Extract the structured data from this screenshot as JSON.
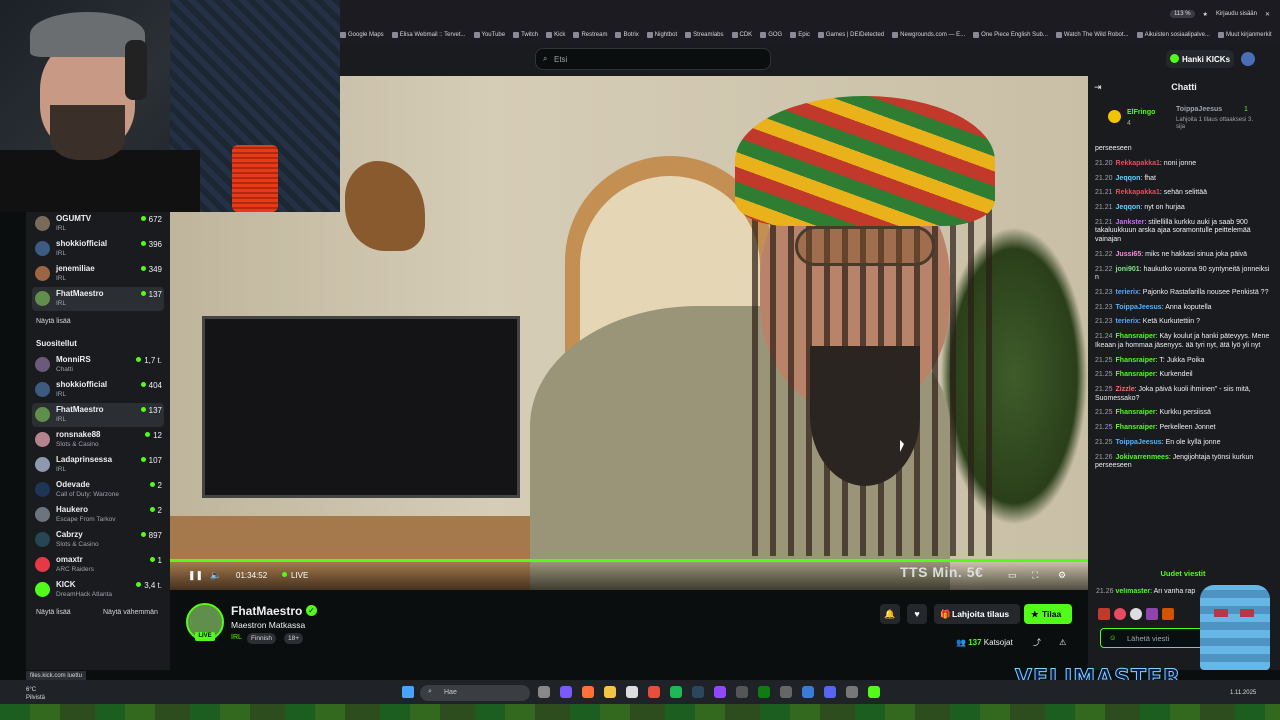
{
  "browser": {
    "bookmarks": [
      "Google Maps",
      "Elisa Webmail :: Tervet...",
      "YouTube",
      "Twitch",
      "Kick",
      "Restream",
      "Botrix",
      "Nightbot",
      "Streamlabs",
      "CDK",
      "GOG",
      "Epic",
      "Games | DEIDetected",
      "Newgrounds.com — E...",
      "One Piece English Sub...",
      "Watch The Wild Robot...",
      "Aikuisten sosiaalipalve...",
      "Muut kirjanmerkit"
    ],
    "zoom": "113 %",
    "login_label": "Kirjaudu sisään"
  },
  "header": {
    "search_placeholder": "Etsi",
    "kicks_button": "Hanki KICKs"
  },
  "sidebar": {
    "followed": [
      {
        "name": "OGUMTV",
        "category": "IRL",
        "viewers": "672"
      },
      {
        "name": "shokkiofficial",
        "category": "IRL",
        "viewers": "396"
      },
      {
        "name": "jenemiliae",
        "category": "IRL",
        "viewers": "349"
      },
      {
        "name": "FhatMaestro",
        "category": "IRL",
        "viewers": "137"
      }
    ],
    "show_more": "Näytä lisää",
    "recommended_heading": "Suositellut",
    "recommended": [
      {
        "name": "MonniRS",
        "category": "Chatti",
        "viewers": "1,7 t."
      },
      {
        "name": "shokkiofficial",
        "category": "IRL",
        "viewers": "404"
      },
      {
        "name": "FhatMaestro",
        "category": "IRL",
        "viewers": "137"
      },
      {
        "name": "ronsnake88",
        "category": "Slots & Casino",
        "viewers": "12"
      },
      {
        "name": "Ladaprinsessa",
        "category": "IRL",
        "viewers": "107"
      },
      {
        "name": "Odevade",
        "category": "Call of Duty: Warzone",
        "viewers": "2"
      },
      {
        "name": "Haukero",
        "category": "Escape From Tarkov",
        "viewers": "2"
      },
      {
        "name": "Cabrzy",
        "category": "Slots & Casino",
        "viewers": "897"
      },
      {
        "name": "omaxtr",
        "category": "ARC Raiders",
        "viewers": "1"
      },
      {
        "name": "KICK",
        "category": "DreamHack Atlanta",
        "viewers": "3,4 t."
      }
    ],
    "show_more_2": "Näytä lisää",
    "show_less": "Näytä vähemmän"
  },
  "player": {
    "time": "01:34:52",
    "live_label": "LIVE",
    "overlay_text": "TTS Min. 5€"
  },
  "channel": {
    "name": "FhatMaestro",
    "live_badge": "LIVE",
    "title": "Maestron Matkassa",
    "category": "IRL",
    "tags": [
      "Finnish",
      "18+"
    ],
    "gift_label": "Lahjoita tilaus",
    "subscribe_label": "Tilaa",
    "viewer_count": "137",
    "viewer_label": "Katsojat"
  },
  "chat": {
    "title": "Chatti",
    "pinned": {
      "rank1_user": "ElFringo",
      "rank1_count": "4",
      "user": "ToippaJeesus",
      "count": "1",
      "text": "Lahjoita 1 tilaus ottaaksesi 3. sija"
    },
    "messages": [
      {
        "time": "",
        "user": "",
        "color": "#efeff1",
        "text": "perseeseen"
      },
      {
        "time": "21.20",
        "user": "Rekkapakka1",
        "color": "#e84a5f",
        "text": "noni jonne"
      },
      {
        "time": "21.20",
        "user": "Jeqqon",
        "color": "#58d6ff",
        "text": "fhat"
      },
      {
        "time": "21.21",
        "user": "Rekkapakka1",
        "color": "#e84a5f",
        "text": "sehän selittää"
      },
      {
        "time": "21.21",
        "user": "Jeqqon",
        "color": "#58d6ff",
        "text": "nyt on hurjaa"
      },
      {
        "time": "21.21",
        "user": "Jankster",
        "color": "#c86bfa",
        "text": "stilellillä kurkku auki ja saab 900 takaluukkuun arska ajaa soramontulle peittelemää vainajan"
      },
      {
        "time": "21.22",
        "user": "Jussi65",
        "color": "#ff8ad8",
        "text": "miks ne hakkasi sinua joka päivä"
      },
      {
        "time": "21.22",
        "user": "joni901",
        "color": "#7ee787",
        "text": "haukutko vuonna 90 syntyneitä jonneiksi n"
      },
      {
        "time": "21.23",
        "user": "terierix",
        "color": "#58a6ff",
        "text": "Pajonko Rastafarilla nousee Penkistä ??"
      },
      {
        "time": "21.23",
        "user": "ToippaJeesus",
        "color": "#4fb3ff",
        "text": "Anna koputella"
      },
      {
        "time": "21.23",
        "user": "terierix",
        "color": "#58a6ff",
        "text": "Ketä Kurkutettiin ?"
      },
      {
        "time": "21.24",
        "user": "Fhansraiper",
        "color": "#53fc18",
        "text": "Käy koulut ja hanki pätevyys. Mene Ikeaan ja hommaa jäsenyys. ää tyri nyt, ätä lyö yli nyt"
      },
      {
        "time": "21.25",
        "user": "Fhansraiper",
        "color": "#53fc18",
        "text": "T: Jukka Poika"
      },
      {
        "time": "21.25",
        "user": "Fhansraiper",
        "color": "#53fc18",
        "text": "Kurkendeil"
      },
      {
        "time": "21.25",
        "user": "Zizzle",
        "color": "#ff6b6b",
        "text": "Joka päivä kuoli ihminen\" - siis mitä, Suomessako?"
      },
      {
        "time": "21.25",
        "user": "Fhansraiper",
        "color": "#53fc18",
        "text": "Kurkku persiissä"
      },
      {
        "time": "21.25",
        "user": "Fhansraiper",
        "color": "#53fc18",
        "text": "Perkelleen Jonnet"
      },
      {
        "time": "21.25",
        "user": "ToippaJeesus",
        "color": "#4fb3ff",
        "text": "En ole kyllä jonne"
      },
      {
        "time": "21.26",
        "user": "Jokivarrenmees",
        "color": "#53fc18",
        "text": "Jengijohtaja työnsi kurkun perseeseen"
      }
    ],
    "new_messages": "Uudet viestit",
    "last_message": {
      "time": "21.26",
      "user": "velimaster",
      "text": "Ari vanha rap"
    },
    "input_placeholder": "Lähetä viesti"
  },
  "overlay": {
    "velimaster": "VELIMASTER"
  },
  "taskbar": {
    "status_url": "files.kick.com luettu",
    "temp": "6°C",
    "weather": "Pilvistä",
    "search": "Hae",
    "date": "1.11.2025"
  }
}
